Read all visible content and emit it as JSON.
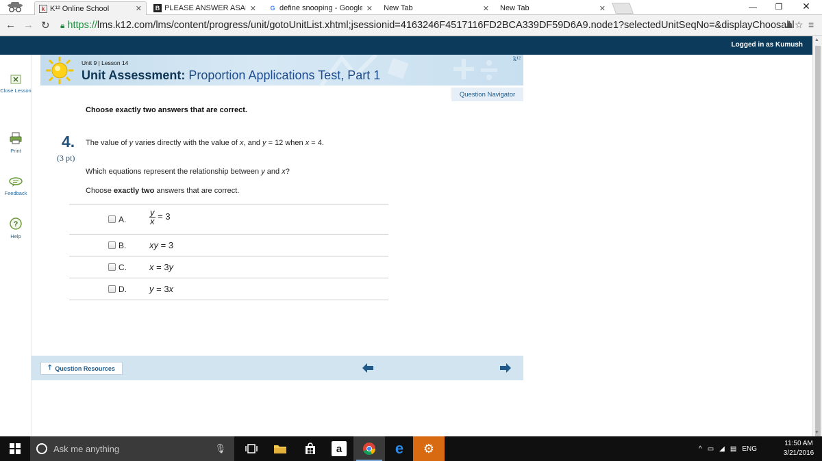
{
  "browser": {
    "tabs": [
      {
        "label": "K¹² Online School",
        "active": true
      },
      {
        "label": "PLEASE ANSWER ASAP!!!!",
        "active": false
      },
      {
        "label": "define snooping - Google",
        "active": false
      },
      {
        "label": "New Tab",
        "active": false
      },
      {
        "label": "New Tab",
        "active": false
      }
    ],
    "url_scheme": "https://",
    "url_rest": "lms.k12.com/lms/content/progress/unit/gotoUnitList.xhtml;jsessionid=4163246F4517116FD2BCA339DF59D6A9.node1?selectedUnitSeqNo=&displayChoosabl"
  },
  "k12": {
    "logged_in": "Logged in as Kumush",
    "logo": "k¹²"
  },
  "sidebar": {
    "items": [
      {
        "label": "Close Lesson",
        "icon": "close-lesson-icon"
      },
      {
        "label": "Print",
        "icon": "print-icon"
      },
      {
        "label": "Feedback",
        "icon": "feedback-icon"
      },
      {
        "label": "Help",
        "icon": "help-icon"
      }
    ]
  },
  "lesson": {
    "unit_label": "Unit 9 | Lesson 14",
    "title_kind": "Unit Assessment:",
    "title_topic": "Proportion Applications Test, Part 1",
    "question_navigator": "Question Navigator"
  },
  "question": {
    "instruction_top": "Choose exactly two answers that are correct.",
    "number": "4.",
    "points": "(3 pt)",
    "stem_a": "The value of ",
    "stem_y": "y",
    "stem_b": " varies directly with the value of ",
    "stem_x": "x",
    "stem_c": ", and ",
    "stem_y2": "y",
    "stem_d": " = 12 when ",
    "stem_x2": "x",
    "stem_e": " = 4.",
    "ask_a": "Which equations represent the relationship between ",
    "ask_y": "y",
    "ask_b": " and ",
    "ask_x": "x",
    "ask_c": "?",
    "choose_a": "Choose ",
    "choose_bold": "exactly two",
    "choose_b": " answers that are correct.",
    "answers": [
      {
        "letter": "A.",
        "num": "y",
        "den": "x",
        "rhs": " = 3"
      },
      {
        "letter": "B.",
        "lhs": "xy",
        "rhs": " = 3"
      },
      {
        "letter": "C.",
        "lhs": "x",
        "mid": " = 3",
        "var": "y"
      },
      {
        "letter": "D.",
        "lhs": "y",
        "mid": " = 3",
        "var": "x"
      }
    ]
  },
  "footer": {
    "question_resources": "Question Resources"
  },
  "taskbar": {
    "search_placeholder": "Ask me anything",
    "language": "ENG",
    "time": "11:50 AM",
    "date": "3/21/2016"
  },
  "colors": {
    "k12_band": "#0b3a5a",
    "accent_blue": "#1f5a8a",
    "header_light": "#d3e4f1"
  }
}
